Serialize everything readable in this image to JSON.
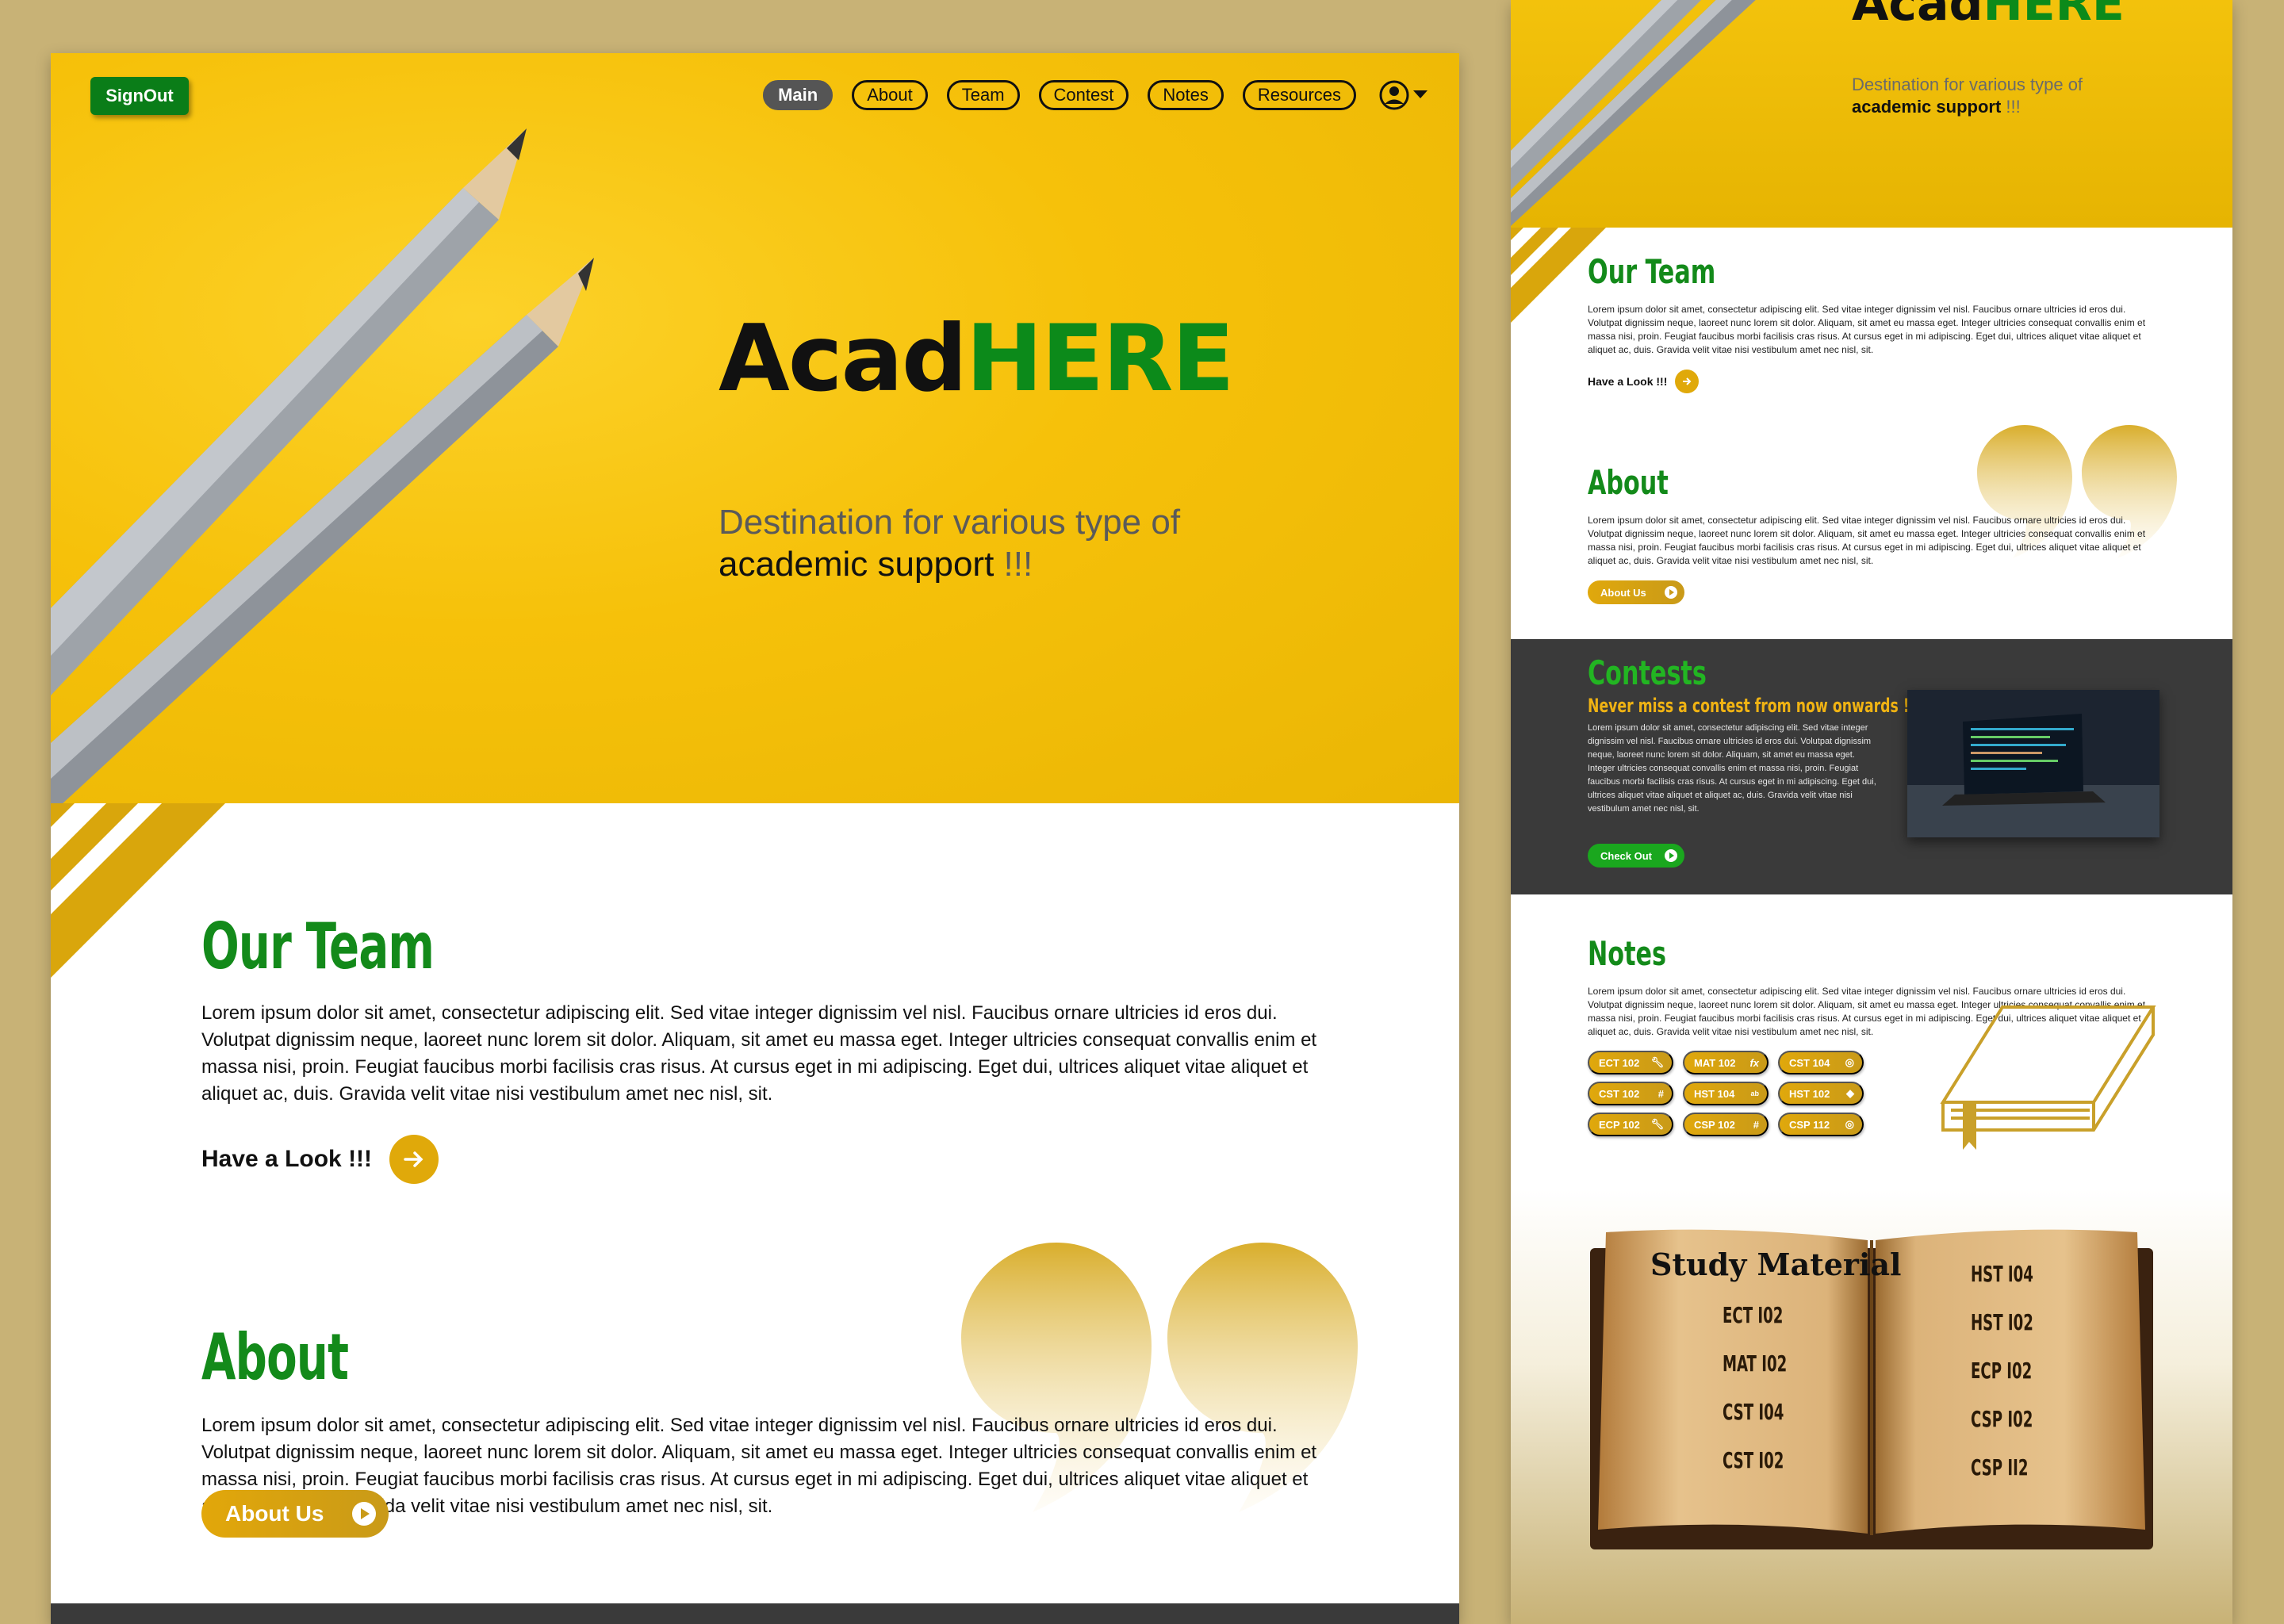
{
  "colors": {
    "brand_green": "#0c8a1a",
    "accent_gold": "#e0a90a",
    "hero_yellow": "#f6c10a",
    "dark": "#3a3a3a",
    "background": "#c8b276"
  },
  "desktop": {
    "signout_label": "SignOut",
    "nav": [
      {
        "label": "Main",
        "active": true
      },
      {
        "label": "About"
      },
      {
        "label": "Team"
      },
      {
        "label": "Contest"
      },
      {
        "label": "Notes"
      },
      {
        "label": "Resources"
      }
    ],
    "profile_icon": "user-circle-icon",
    "brand_part1": "Acad",
    "brand_part2": "HERE",
    "tagline_line1": "Destination for various type of",
    "tagline_bold": "academic support",
    "tagline_end": " !!!",
    "team": {
      "title": "Our Team",
      "text": "Lorem ipsum dolor sit amet, consectetur adipiscing elit. Sed vitae integer dignissim vel nisl. Faucibus ornare ultricies id eros dui. Volutpat dignissim neque, laoreet nunc lorem sit dolor. Aliquam, sit amet eu massa eget. Integer ultricies consequat convallis enim et massa nisi, proin. Feugiat faucibus morbi facilisis cras risus. At cursus eget in mi adipiscing. Eget dui, ultrices aliquet vitae aliquet et aliquet ac, duis. Gravida velit vitae nisi vestibulum amet nec nisl, sit.",
      "cta": "Have a Look !!!"
    },
    "about": {
      "title": "About",
      "text": "Lorem ipsum dolor sit amet, consectetur adipiscing elit. Sed vitae integer dignissim vel nisl. Faucibus ornare ultricies id eros dui. Volutpat dignissim neque, laoreet nunc lorem sit dolor. Aliquam, sit amet eu massa eget. Integer ultricies consequat convallis enim et massa nisi, proin. Feugiat faucibus morbi facilisis cras risus. At cursus eget in mi adipiscing. Eget dui, ultrices aliquet vitae aliquet et aliquet ac, duis. Gravida velit vitae nisi vestibulum amet nec nisl, sit.",
      "cta": "About Us"
    }
  },
  "mobile": {
    "brand_part1": "Acad",
    "brand_part2": "HERE",
    "tagline_line1": "Destination for various type of",
    "tagline_bold": "academic support",
    "tagline_end": " !!!",
    "team": {
      "title": "Our Team",
      "text": "Lorem ipsum dolor sit amet, consectetur adipiscing elit. Sed vitae integer dignissim vel nisl. Faucibus ornare ultricies id eros dui. Volutpat dignissim neque, laoreet nunc lorem sit dolor. Aliquam, sit amet eu massa eget. Integer ultricies consequat convallis enim et massa nisi, proin. Feugiat faucibus morbi facilisis cras risus. At cursus eget in mi adipiscing. Eget dui, ultrices aliquet vitae aliquet et aliquet ac, duis. Gravida velit vitae nisi vestibulum amet nec nisl, sit.",
      "cta": "Have a Look !!!"
    },
    "about": {
      "title": "About",
      "text": "Lorem ipsum dolor sit amet, consectetur adipiscing elit. Sed vitae integer dignissim vel nisl. Faucibus ornare ultricies id eros dui. Volutpat dignissim neque, laoreet nunc lorem sit dolor. Aliquam, sit amet eu massa eget. Integer ultricies consequat convallis enim et massa nisi, proin. Feugiat faucibus morbi facilisis cras risus. At cursus eget in mi adipiscing. Eget dui, ultrices aliquet vitae aliquet et aliquet ac, duis. Gravida velit vitae nisi vestibulum amet nec nisl, sit.",
      "cta": "About Us"
    },
    "contests": {
      "title": "Contests",
      "subtitle": "Never miss a contest from now onwards !!!",
      "text": "Lorem ipsum dolor sit amet, consectetur adipiscing elit. Sed vitae integer dignissim vel nisl. Faucibus ornare ultricies id eros dui. Volutpat dignissim neque, laoreet nunc lorem sit dolor. Aliquam, sit amet eu massa eget. Integer ultricies consequat convallis enim et massa nisi, proin. Feugiat faucibus morbi facilisis cras risus. At cursus eget in mi adipiscing. Eget dui, ultrices aliquet vitae aliquet et aliquet ac, duis. Gravida velit vitae nisi vestibulum amet nec nisl, sit.",
      "cta": "Check Out"
    },
    "notes": {
      "title": "Notes",
      "text": "Lorem ipsum dolor sit amet, consectetur adipiscing elit. Sed vitae integer dignissim vel nisl. Faucibus ornare ultricies id eros dui. Volutpat dignissim neque, laoreet nunc lorem sit dolor. Aliquam, sit amet eu massa eget. Integer ultricies consequat convallis enim et massa nisi, proin. Feugiat faucibus morbi facilisis cras risus. At cursus eget in mi adipiscing. Eget dui, ultrices aliquet vitae aliquet et aliquet ac, duis. Gravida velit vitae nisi vestibulum amet nec nisl, sit.",
      "tags": [
        {
          "label": "ECT 102",
          "icon": "wrench-icon"
        },
        {
          "label": "MAT 102",
          "icon": "function-icon"
        },
        {
          "label": "CST 104",
          "icon": "globe-icon"
        },
        {
          "label": "CST 102",
          "icon": "hash-icon"
        },
        {
          "label": "HST 104",
          "icon": "ab-icon"
        },
        {
          "label": "HST 102",
          "icon": "shield-icon"
        },
        {
          "label": "ECP 102",
          "icon": "wrench-icon"
        },
        {
          "label": "CSP 102",
          "icon": "hash-icon"
        },
        {
          "label": "CSP 112",
          "icon": "globe-icon"
        }
      ]
    },
    "study": {
      "title": "Study Material",
      "left_items": [
        "ECT I02",
        "MAT I02",
        "CST I04",
        "CST I02"
      ],
      "right_items": [
        "HST I04",
        "HST I02",
        "ECP I02",
        "CSP I02",
        "CSP II2"
      ]
    }
  }
}
